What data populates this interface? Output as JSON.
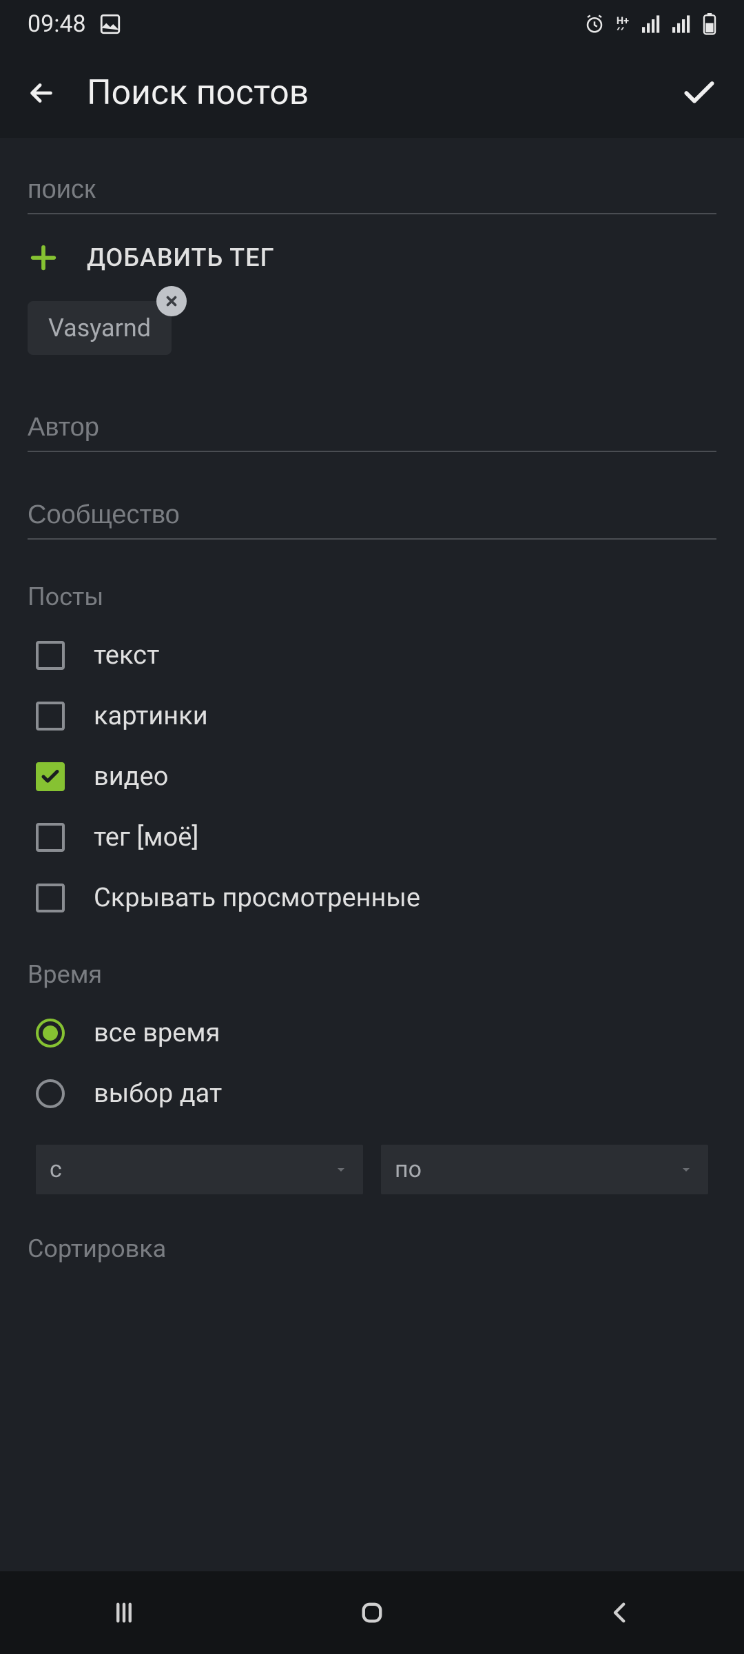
{
  "status": {
    "time": "09:48"
  },
  "header": {
    "title": "Поиск постов"
  },
  "search": {
    "placeholder": "поиск",
    "value": "",
    "add_tag_label": "ДОБАВИТЬ ТЕГ",
    "tags": [
      {
        "label": "Vasyarnd"
      }
    ]
  },
  "author": {
    "placeholder": "Автор",
    "value": ""
  },
  "community": {
    "placeholder": "Сообщество",
    "value": ""
  },
  "posts": {
    "heading": "Посты",
    "items": [
      {
        "label": "текст",
        "checked": false
      },
      {
        "label": "картинки",
        "checked": false
      },
      {
        "label": "видео",
        "checked": true
      },
      {
        "label": "тег [моё]",
        "checked": false
      },
      {
        "label": "Скрывать просмотренные",
        "checked": false
      }
    ]
  },
  "time": {
    "heading": "Время",
    "options": [
      {
        "label": "все время",
        "selected": true
      },
      {
        "label": "выбор дат",
        "selected": false
      }
    ],
    "from_label": "с",
    "to_label": "по"
  },
  "sort": {
    "heading": "Сортировка"
  }
}
